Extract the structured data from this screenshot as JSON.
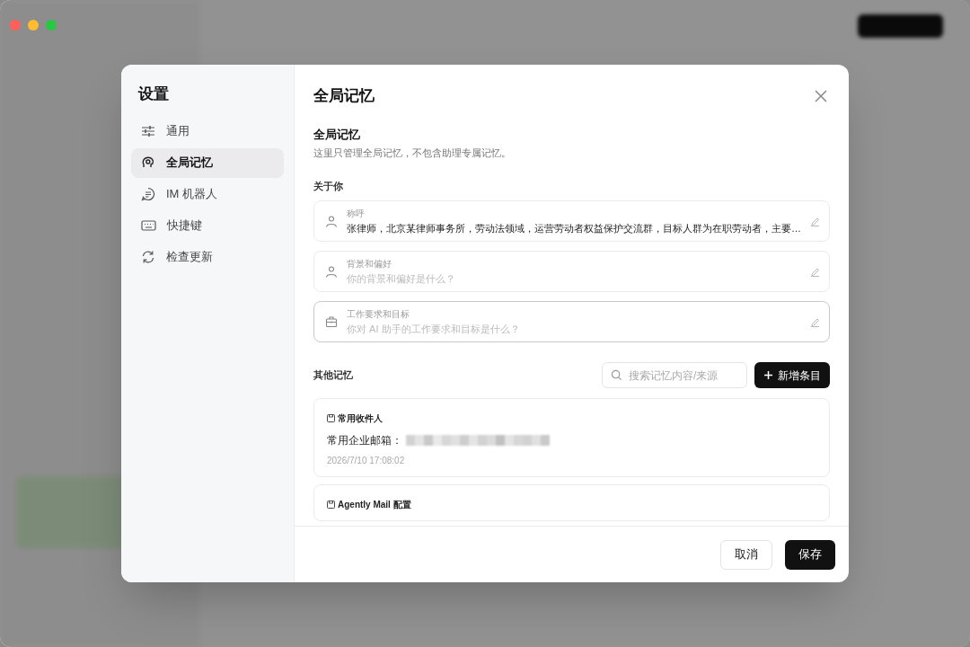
{
  "settings": {
    "title": "设置",
    "nav": [
      {
        "label": "通用",
        "selected": false
      },
      {
        "label": "全局记忆",
        "selected": true
      },
      {
        "label": "IM 机器人",
        "selected": false
      },
      {
        "label": "快捷键",
        "selected": false
      },
      {
        "label": "检查更新",
        "selected": false
      }
    ]
  },
  "panel": {
    "title": "全局记忆",
    "section_title": "全局记忆",
    "description": "这里只管理全局记忆，不包含助理专属记忆。",
    "about_label": "关于你",
    "fields": [
      {
        "label": "称呼",
        "value": "张律师，北京某律师事务所，劳动法领域，运营劳动者权益保护交流群，目标人群为在职劳动者，主要…",
        "focused": false
      },
      {
        "label": "背景和偏好",
        "placeholder": "你的背景和偏好是什么？",
        "focused": false
      },
      {
        "label": "工作要求和目标",
        "placeholder": "你对 AI 助手的工作要求和目标是什么？",
        "focused": true
      }
    ],
    "other_label": "其他记忆",
    "search": {
      "placeholder": "搜索记忆内容/来源"
    },
    "add_button": "新增条目",
    "memories": [
      {
        "title": "常用收件人",
        "content": "常用企业邮箱：",
        "redacted": true,
        "time": "2026/7/10 17:08:02"
      },
      {
        "title": "Agently Mail 配置"
      }
    ],
    "buttons": {
      "cancel": "取消",
      "save": "保存"
    }
  }
}
